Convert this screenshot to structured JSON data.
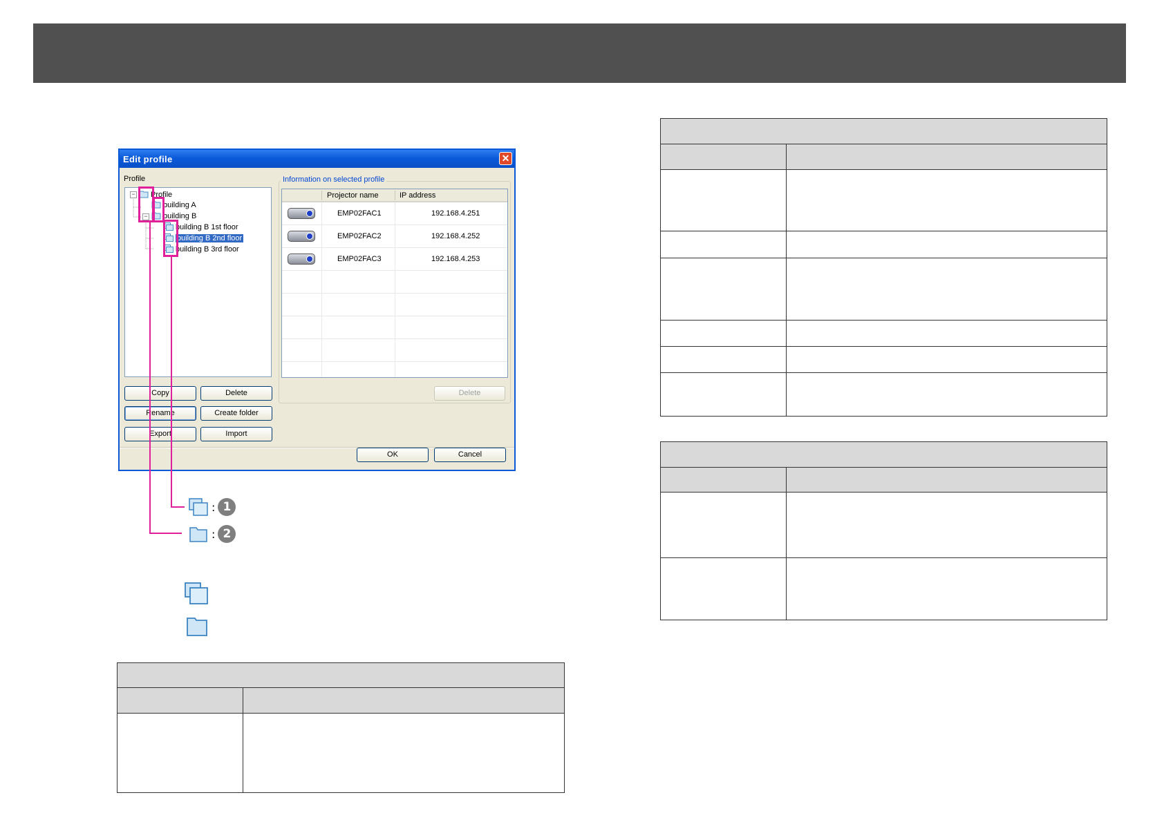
{
  "dialog": {
    "title": "Edit profile",
    "close_glyph": "✕",
    "profile_label": "Profile",
    "tree": [
      {
        "label": "Profile",
        "level": 0,
        "icon": "folder-icon",
        "expander": "−"
      },
      {
        "label": "building A",
        "level": 1,
        "icon": "folder-icon"
      },
      {
        "label": "building B",
        "level": 1,
        "icon": "folder-icon",
        "expander": "−"
      },
      {
        "label": "building B 1st floor",
        "level": 2,
        "icon": "group-folder-icon"
      },
      {
        "label": "building B 2nd floor",
        "level": 2,
        "icon": "group-folder-icon",
        "selected": true
      },
      {
        "label": "building B 3rd floor",
        "level": 2,
        "icon": "group-folder-icon"
      }
    ],
    "info_group_label": "Information on selected profile",
    "columns": [
      "Projector name",
      "IP address"
    ],
    "rows": [
      {
        "name": "EMP02FAC1",
        "ip": "192.168.4.251"
      },
      {
        "name": "EMP02FAC2",
        "ip": "192.168.4.252"
      },
      {
        "name": "EMP02FAC3",
        "ip": "192.168.4.253"
      }
    ],
    "buttons": {
      "copy": "Copy",
      "delete": "Delete",
      "rename": "Rename",
      "create_folder": "Create folder",
      "export": "Export",
      "import": "Import",
      "delete_disabled": "Delete",
      "ok": "OK",
      "cancel": "Cancel"
    }
  },
  "legend": [
    {
      "icon": "group-folder-icon",
      "separator": ":",
      "number": "1"
    },
    {
      "icon": "folder-icon",
      "separator": ":",
      "number": "2"
    }
  ],
  "colors": {
    "header_bar": "#505050",
    "callout": "#e0209a",
    "table_header": "#d9d9d9",
    "dialog_blue": "#0a58d6",
    "selection": "#316ac5"
  }
}
